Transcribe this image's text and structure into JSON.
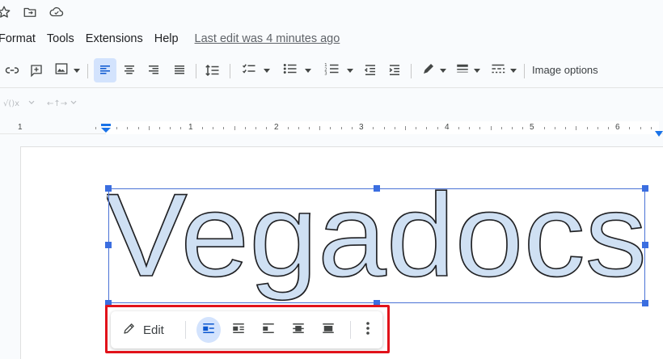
{
  "title_row": {
    "icons": [
      "star-icon",
      "move-to-folder-icon",
      "cloud-saved-icon"
    ]
  },
  "menu": {
    "items": [
      "Format",
      "Tools",
      "Extensions",
      "Help"
    ],
    "last_edit": "Last edit was 4 minutes ago"
  },
  "toolbar": {
    "image_options": "Image options",
    "icons": [
      "insert-link-icon",
      "insert-comment-icon",
      "insert-image-icon",
      "align-left-icon",
      "align-center-icon",
      "align-right-icon",
      "justify-icon",
      "line-spacing-icon",
      "checklist-icon",
      "bulleted-list-icon",
      "numbered-list-icon",
      "decrease-indent-icon",
      "increase-indent-icon",
      "border-color-icon",
      "border-weight-icon",
      "border-dash-icon"
    ],
    "active_alignment": "left"
  },
  "equation_row": {
    "icons": [
      "equation-icon",
      "arrows-icon"
    ]
  },
  "ruler": {
    "numbers": [
      "1",
      "1",
      "2",
      "3",
      "4",
      "5",
      "6"
    ]
  },
  "document": {
    "word_art_text": "Vegadocs",
    "word_art_fill": "#cfe0f3",
    "word_art_stroke": "#202124"
  },
  "floating_toolbar": {
    "edit_label": "Edit",
    "buttons": [
      "inline-icon",
      "wrap-text-icon",
      "break-text-icon",
      "behind-text-icon",
      "in-front-of-text-icon",
      "more-options-icon"
    ],
    "active_button": "inline"
  },
  "colors": {
    "accent": "#0b57d0",
    "active_bg": "#d3e3fd",
    "highlight_outline": "#e1121a",
    "selection": "#3b6ee0"
  }
}
